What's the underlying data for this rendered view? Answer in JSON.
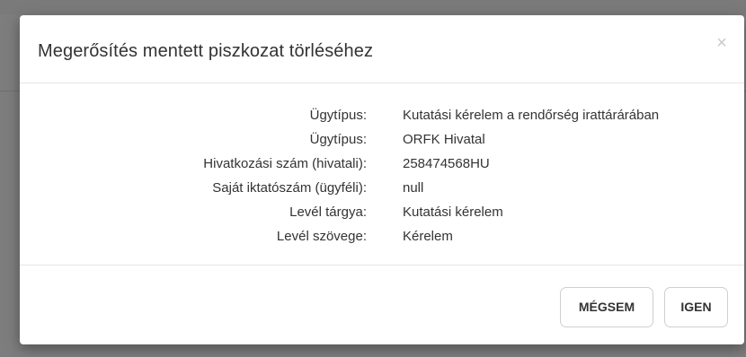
{
  "dialog": {
    "title": "Megerősítés mentett piszkozat törléséhez",
    "close_glyph": "×",
    "rows": [
      {
        "label": "Ügytípus:",
        "value": "Kutatási kérelem a rendőrség irattárárában"
      },
      {
        "label": "Ügytípus:",
        "value": "ORFK Hivatal"
      },
      {
        "label": "Hivatkozási szám (hivatali):",
        "value": "258474568HU"
      },
      {
        "label": "Saját iktatószám (ügyféli):",
        "value": "null"
      },
      {
        "label": "Levél tárgya:",
        "value": "Kutatási kérelem"
      },
      {
        "label": "Levél szövege:",
        "value": "Kérelem"
      }
    ],
    "buttons": {
      "cancel": "MÉGSEM",
      "confirm": "IGEN"
    }
  },
  "icons": {
    "close": "close-icon"
  }
}
